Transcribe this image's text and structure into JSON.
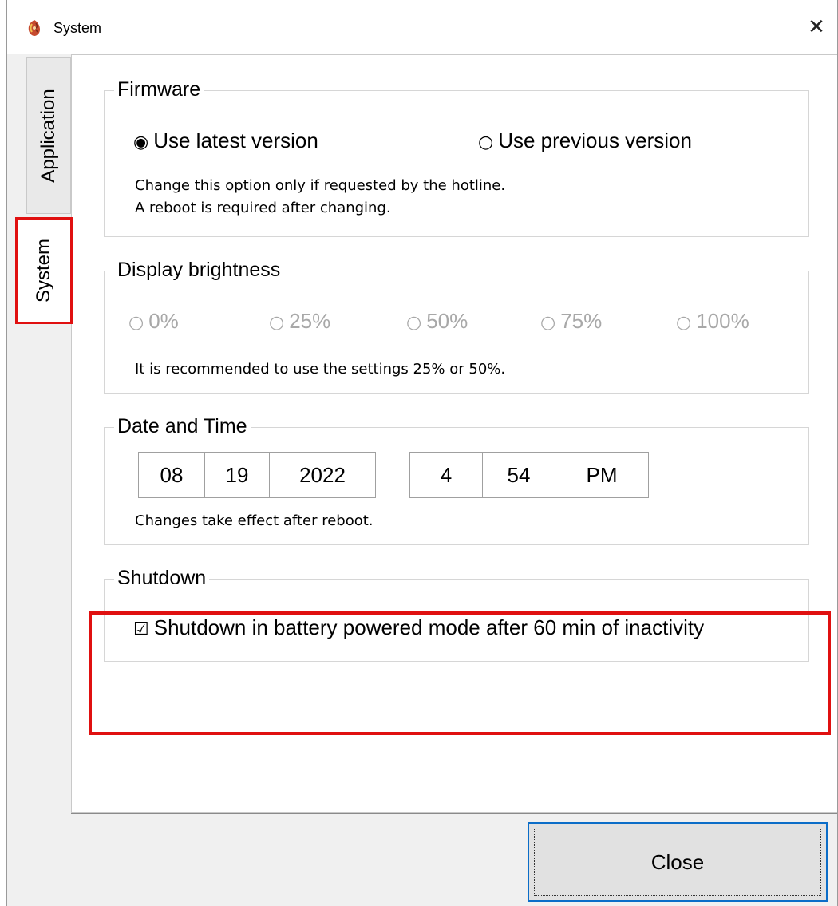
{
  "window": {
    "title": "System",
    "icon": "app-icon",
    "close_glyph": "✕"
  },
  "tabs": [
    {
      "label": "Application",
      "selected": false
    },
    {
      "label": "System",
      "selected": true
    }
  ],
  "firmware": {
    "legend": "Firmware",
    "options": [
      {
        "label": "Use latest version",
        "checked": true
      },
      {
        "label": "Use previous version",
        "checked": false
      }
    ],
    "note_line1": "Change this option only if requested by the hotline.",
    "note_line2": "A reboot is required after changing."
  },
  "brightness": {
    "legend": "Display brightness",
    "enabled": false,
    "options": [
      {
        "label": "0%",
        "checked": false
      },
      {
        "label": "25%",
        "checked": false
      },
      {
        "label": "50%",
        "checked": false
      },
      {
        "label": "75%",
        "checked": false
      },
      {
        "label": "100%",
        "checked": false
      }
    ],
    "note": "It is recommended to use the settings 25% or 50%."
  },
  "datetime": {
    "legend": "Date and Time",
    "month": "08",
    "day": "19",
    "year": "2022",
    "hour": "4",
    "minute": "54",
    "ampm": "PM",
    "note": "Changes take effect after reboot."
  },
  "shutdown": {
    "legend": "Shutdown",
    "checkbox_label": "Shutdown in battery powered mode after 60 min of inactivity",
    "checked": true
  },
  "footer": {
    "close_label": "Close"
  },
  "colors": {
    "highlight": "#e01010",
    "focus_border": "#0b6dc8"
  }
}
